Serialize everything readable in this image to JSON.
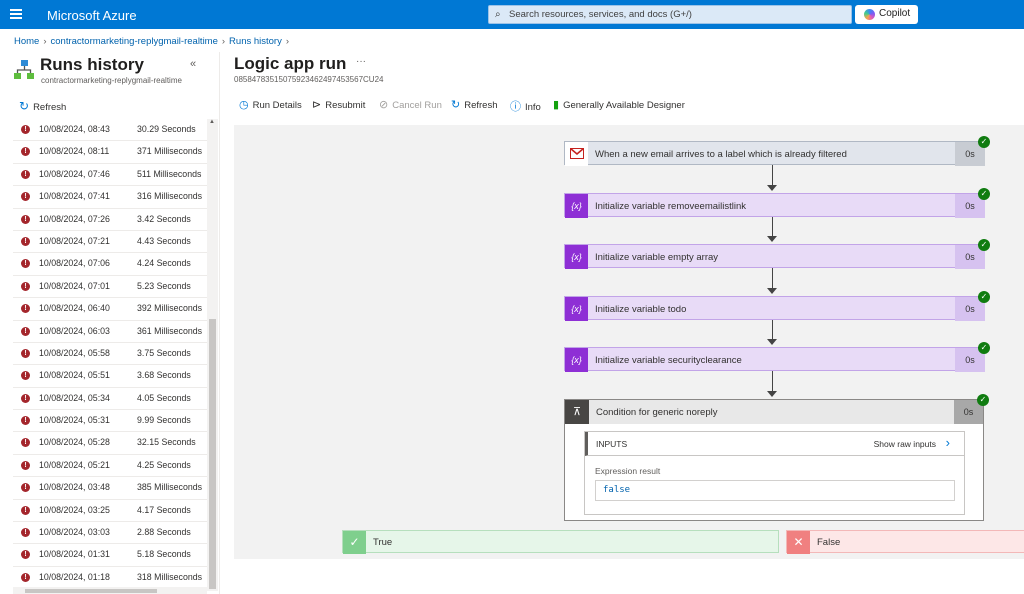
{
  "topbar": {
    "brand": "Microsoft Azure",
    "search_placeholder": "Search resources, services, and docs (G+/)",
    "copilot": "Copilot"
  },
  "breadcrumb": [
    "Home",
    "contractormarketing-replygmail-realtime",
    "Runs history"
  ],
  "left": {
    "title": "Runs history",
    "subtitle": "contractormarketing-replygmail-realtime",
    "refresh": "Refresh",
    "runs": [
      {
        "date": "10/08/2024, 08:43",
        "duration": "30.29 Seconds"
      },
      {
        "date": "10/08/2024, 08:11",
        "duration": "371 Milliseconds"
      },
      {
        "date": "10/08/2024, 07:46",
        "duration": "511 Milliseconds"
      },
      {
        "date": "10/08/2024, 07:41",
        "duration": "316 Milliseconds"
      },
      {
        "date": "10/08/2024, 07:26",
        "duration": "3.42 Seconds"
      },
      {
        "date": "10/08/2024, 07:21",
        "duration": "4.43 Seconds"
      },
      {
        "date": "10/08/2024, 07:06",
        "duration": "4.24 Seconds"
      },
      {
        "date": "10/08/2024, 07:01",
        "duration": "5.23 Seconds"
      },
      {
        "date": "10/08/2024, 06:40",
        "duration": "392 Milliseconds"
      },
      {
        "date": "10/08/2024, 06:03",
        "duration": "361 Milliseconds"
      },
      {
        "date": "10/08/2024, 05:58",
        "duration": "3.75 Seconds"
      },
      {
        "date": "10/08/2024, 05:51",
        "duration": "3.68 Seconds"
      },
      {
        "date": "10/08/2024, 05:34",
        "duration": "4.05 Seconds"
      },
      {
        "date": "10/08/2024, 05:31",
        "duration": "9.99 Seconds"
      },
      {
        "date": "10/08/2024, 05:28",
        "duration": "32.15 Seconds"
      },
      {
        "date": "10/08/2024, 05:21",
        "duration": "4.25 Seconds"
      },
      {
        "date": "10/08/2024, 03:48",
        "duration": "385 Milliseconds"
      },
      {
        "date": "10/08/2024, 03:25",
        "duration": "4.17 Seconds"
      },
      {
        "date": "10/08/2024, 03:03",
        "duration": "2.88 Seconds"
      },
      {
        "date": "10/08/2024, 01:31",
        "duration": "5.18 Seconds"
      },
      {
        "date": "10/08/2024, 01:18",
        "duration": "318 Milliseconds"
      }
    ]
  },
  "main": {
    "title": "Logic app run",
    "run_id": "08584783515075923462497453567CU24",
    "toolbar": {
      "run_details": "Run Details",
      "resubmit": "Resubmit",
      "cancel_run": "Cancel Run",
      "refresh": "Refresh",
      "info": "Info",
      "designer": "Generally Available Designer"
    },
    "steps": [
      {
        "label": "When a new email arrives to a label which is already filtered",
        "duration": "0s",
        "icon": "gmail-icon"
      },
      {
        "label": "Initialize variable removeemailistlink",
        "duration": "0s",
        "icon": "variable-icon"
      },
      {
        "label": "Initialize variable empty array",
        "duration": "0s",
        "icon": "variable-icon"
      },
      {
        "label": "Initialize variable todo",
        "duration": "0s",
        "icon": "variable-icon"
      },
      {
        "label": "Initialize variable securityclearance",
        "duration": "0s",
        "icon": "variable-icon"
      }
    ],
    "condition": {
      "label": "Condition for generic noreply",
      "duration": "0s",
      "inputs_label": "INPUTS",
      "show_raw": "Show raw inputs",
      "expr_label": "Expression result",
      "expr_value": "false"
    },
    "branch_true": "True",
    "branch_false": "False",
    "colors": {
      "accent": "#0078d4",
      "error": "#a4262c",
      "success": "#107c10",
      "variable": "#8e2fd5"
    }
  }
}
